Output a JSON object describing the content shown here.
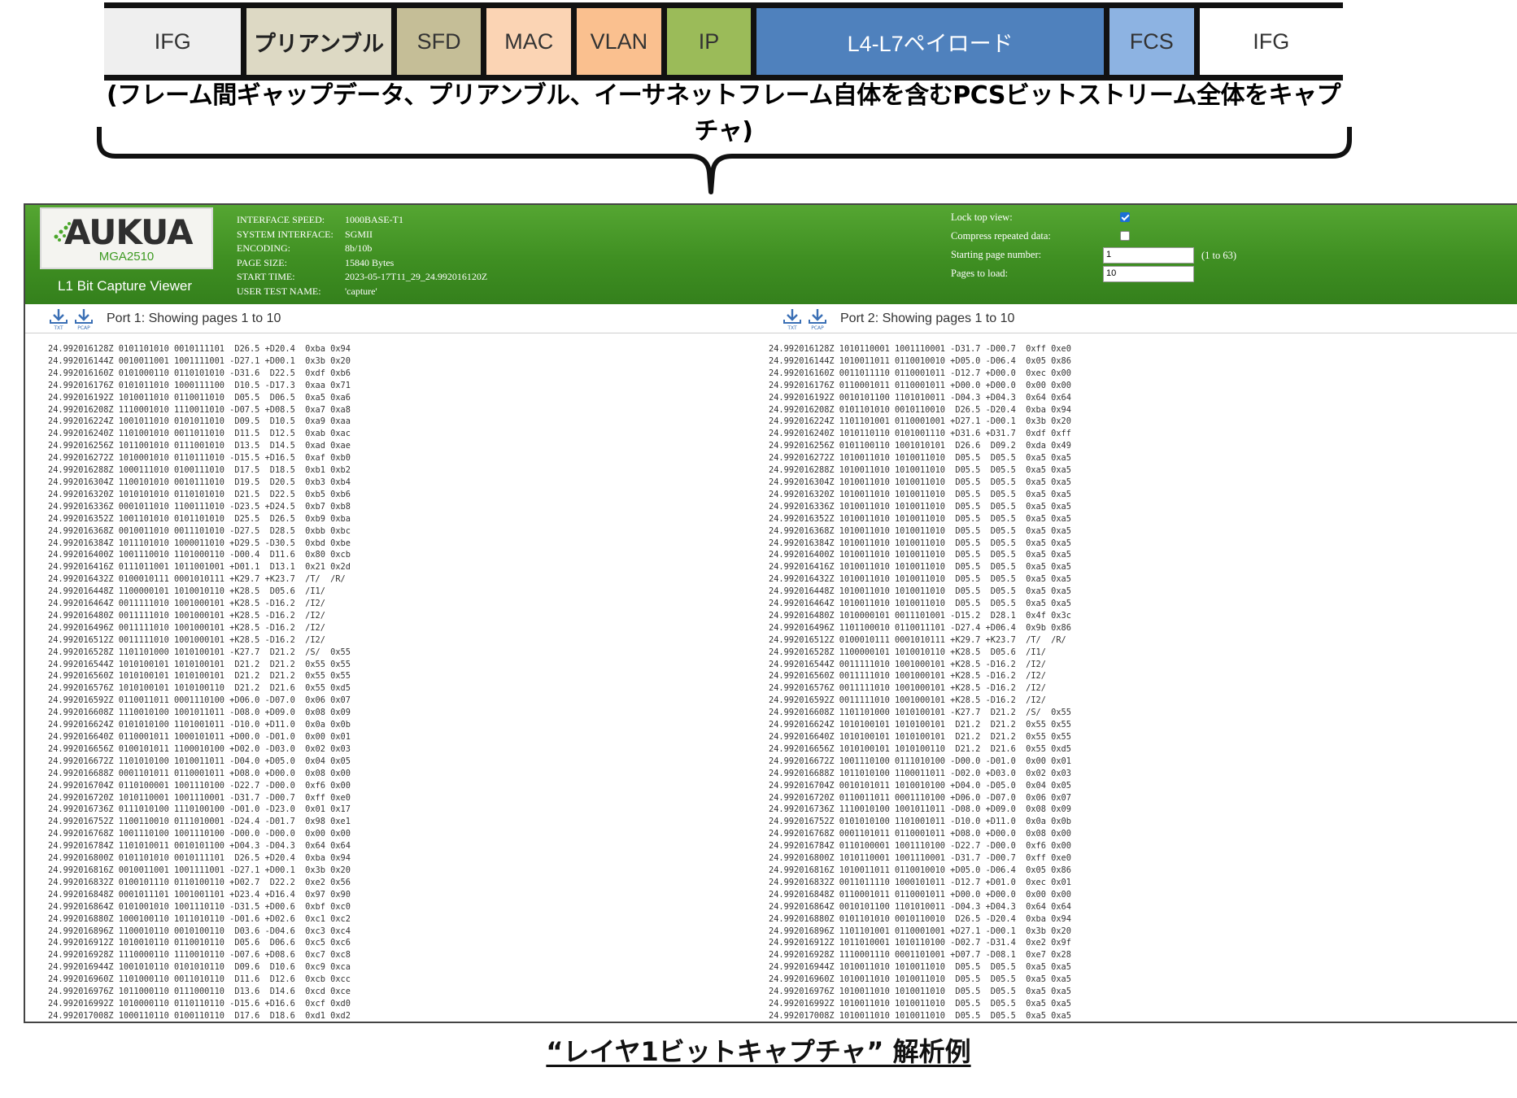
{
  "frame_strip": {
    "segments": [
      {
        "label": "IFG",
        "color": "#efefef",
        "text_color": "#333333",
        "bold": false
      },
      {
        "label": "プリアンブル",
        "color": "#ddd9c4",
        "text_color": "#222222",
        "bold": true
      },
      {
        "label": "SFD",
        "color": "#c5be97",
        "text_color": "#333333",
        "bold": false
      },
      {
        "label": "MAC",
        "color": "#fbd4b4",
        "text_color": "#333333",
        "bold": false
      },
      {
        "label": "VLAN",
        "color": "#fac08f",
        "text_color": "#333333",
        "bold": false
      },
      {
        "label": "IP",
        "color": "#9bbb59",
        "text_color": "#333333",
        "bold": false
      },
      {
        "label": "L4-L7ペイロード",
        "color": "#4f81bd",
        "text_color": "#ffffff",
        "bold": false
      },
      {
        "label": "FCS",
        "color": "#8db3e2",
        "text_color": "#333333",
        "bold": false
      },
      {
        "label": "IFG",
        "color": "#ffffff",
        "text_color": "#333333",
        "bold": false
      }
    ],
    "caption": "(フレーム間ギャップデータ、プリアンブル、イーサネットフレーム自体を含むPCSビットストリーム全体をキャプチャ)"
  },
  "viewer": {
    "logo_text": "AUKUA",
    "logo_model": "MGA2510",
    "app_title": "L1 Bit Capture Viewer",
    "info": [
      {
        "label": "INTERFACE SPEED:",
        "value": "1000BASE-T1"
      },
      {
        "label": "SYSTEM INTERFACE:",
        "value": "SGMII"
      },
      {
        "label": "ENCODING:",
        "value": "8b/10b"
      },
      {
        "label": "PAGE SIZE:",
        "value": "15840 Bytes"
      },
      {
        "label": "START TIME:",
        "value": "2023-05-17T11_29_24.992016120Z"
      },
      {
        "label": "USER TEST NAME:",
        "value": "'capture'"
      }
    ],
    "options": {
      "lock_top_view_label": "Lock top view:",
      "lock_top_view_checked": true,
      "compress_label": "Compress repeated data:",
      "compress_checked": false,
      "start_page_label": "Starting page number:",
      "start_page_value": "1",
      "start_page_hint": "(1 to 63)",
      "pages_to_load_label": "Pages to load:",
      "pages_to_load_value": "10"
    },
    "port1_title": "Port 1: Showing pages 1 to 10",
    "port2_title": "Port 2: Showing pages 1 to 10",
    "download_icons": [
      "txt-download-icon",
      "pcap-download-icon"
    ],
    "port1_lines": [
      "24.992016128Z 0101101010 0010111101  D26.5 +D20.4  0xba 0x94",
      "24.992016144Z 0010011001 1001111001 -D27.1 +D00.1  0x3b 0x20",
      "24.992016160Z 0101000110 0110101010 -D31.6  D22.5  0xdf 0xb6",
      "24.992016176Z 0101011010 1000111100  D10.5 -D17.3  0xaa 0x71",
      "24.992016192Z 1010011010 0110011010  D05.5  D06.5  0xa5 0xa6",
      "24.992016208Z 1110001010 1110011010 -D07.5 +D08.5  0xa7 0xa8",
      "24.992016224Z 1001011010 0101011010  D09.5  D10.5  0xa9 0xaa",
      "24.992016240Z 1101001010 0011011010  D11.5  D12.5  0xab 0xac",
      "24.992016256Z 1011001010 0111001010  D13.5  D14.5  0xad 0xae",
      "24.992016272Z 1010001010 0110111010 -D15.5 +D16.5  0xaf 0xb0",
      "24.992016288Z 1000111010 0100111010  D17.5  D18.5  0xb1 0xb2",
      "24.992016304Z 1100101010 0010111010  D19.5  D20.5  0xb3 0xb4",
      "24.992016320Z 1010101010 0110101010  D21.5  D22.5  0xb5 0xb6",
      "24.992016336Z 0001011010 1100111010 -D23.5 +D24.5  0xb7 0xb8",
      "24.992016352Z 1001101010 0101101010  D25.5  D26.5  0xb9 0xba",
      "24.992016368Z 0010011010 0011101010 -D27.5  D28.5  0xbb 0xbc",
      "24.992016384Z 1011101010 1000011010 +D29.5 -D30.5  0xbd 0xbe",
      "24.992016400Z 1001110010 1101000110 -D00.4  D11.6  0x80 0xcb",
      "24.992016416Z 0111011001 1011001001 +D01.1  D13.1  0x21 0x2d",
      "24.992016432Z 0100010111 0001010111 +K29.7 +K23.7  /T/  /R/",
      "24.992016448Z 1100000101 1010010110 +K28.5  D05.6  /I1/",
      "24.992016464Z 0011111010 1001000101 +K28.5 -D16.2  /I2/",
      "24.992016480Z 0011111010 1001000101 +K28.5 -D16.2  /I2/",
      "24.992016496Z 0011111010 1001000101 +K28.5 -D16.2  /I2/",
      "24.992016512Z 0011111010 1001000101 +K28.5 -D16.2  /I2/",
      "24.992016528Z 1101101000 1010100101 -K27.7  D21.2  /S/  0x55",
      "24.992016544Z 1010100101 1010100101  D21.2  D21.2  0x55 0x55",
      "24.992016560Z 1010100101 1010100101  D21.2  D21.2  0x55 0x55",
      "24.992016576Z 1010100101 1010100110  D21.2  D21.6  0x55 0xd5",
      "24.992016592Z 0110011011 0001110100 +D06.0 -D07.0  0x06 0x07",
      "24.992016608Z 1110010100 1001011011 -D08.0 +D09.0  0x08 0x09",
      "24.992016624Z 0101010100 1101001011 -D10.0 +D11.0  0x0a 0x0b",
      "24.992016640Z 0110001011 1000101011 +D00.0 -D01.0  0x00 0x01",
      "24.992016656Z 0100101011 1100010100 +D02.0 -D03.0  0x02 0x03",
      "24.992016672Z 1101010100 1010011011 -D04.0 +D05.0  0x04 0x05",
      "24.992016688Z 0001101011 0110001011 +D08.0 +D00.0  0x08 0x00",
      "24.992016704Z 0110100001 1001110100 -D22.7 -D00.0  0xf6 0x00",
      "24.992016720Z 1010110001 1001110001 -D31.7 -D00.7  0xff 0xe0",
      "24.992016736Z 0111010100 1110100100 -D01.0 -D23.0  0x01 0x17",
      "24.992016752Z 1100110010 0111010001 -D24.4 -D01.7  0x98 0xe1",
      "24.992016768Z 1001110100 1001110100 -D00.0 -D00.0  0x00 0x00",
      "24.992016784Z 1101010011 0010101100 +D04.3 -D04.3  0x64 0x64",
      "24.992016800Z 0101101010 0010111101  D26.5 +D20.4  0xba 0x94",
      "24.992016816Z 0010011001 1001111001 -D27.1 +D00.1  0x3b 0x20",
      "24.992016832Z 0100101110 0110100110 +D02.7  D22.2  0xe2 0x56",
      "24.992016848Z 0001011101 1001001101 +D23.4 +D16.4  0x97 0x90",
      "24.992016864Z 0101001010 1001110110 -D31.5 +D00.6  0xbf 0xc0",
      "24.992016880Z 1000100110 1011010110 -D01.6 +D02.6  0xc1 0xc2",
      "24.992016896Z 1100010110 0010100110  D03.6 -D04.6  0xc3 0xc4",
      "24.992016912Z 1010010110 0110010110  D05.6  D06.6  0xc5 0xc6",
      "24.992016928Z 1110000110 1110010110 -D07.6 +D08.6  0xc7 0xc8",
      "24.992016944Z 1001010110 0101010110  D09.6  D10.6  0xc9 0xca",
      "24.992016960Z 1101000110 0011010110  D11.6  D12.6  0xcb 0xcc",
      "24.992016976Z 1011000110 0111000110  D13.6  D14.6  0xcd 0xce",
      "24.992016992Z 1010000110 0110110110 -D15.6 +D16.6  0xcf 0xd0",
      "24.992017008Z 1000110110 0100110110  D17.6  D18.6  0xd1 0xd2"
    ],
    "port2_lines": [
      "24.992016128Z 1010110001 1001110001 -D31.7 -D00.7  0xff 0xe0",
      "24.992016144Z 1010011011 0110010010 +D05.0 -D06.4  0x05 0x86",
      "24.992016160Z 0011011110 0110001011 -D12.7 +D00.0  0xec 0x00",
      "24.992016176Z 0110001011 0110001011 +D00.0 +D00.0  0x00 0x00",
      "24.992016192Z 0010101100 1101010011 -D04.3 +D04.3  0x64 0x64",
      "24.992016208Z 0101101010 0010110010  D26.5 -D20.4  0xba 0x94",
      "24.992016224Z 1101101001 0110001001 +D27.1 -D00.1  0x3b 0x20",
      "24.992016240Z 1010110110 0101001110 +D31.6 +D31.7  0xdf 0xff",
      "24.992016256Z 0101100110 1001010101  D26.6  D09.2  0xda 0x49",
      "24.992016272Z 1010011010 1010011010  D05.5  D05.5  0xa5 0xa5",
      "24.992016288Z 1010011010 1010011010  D05.5  D05.5  0xa5 0xa5",
      "24.992016304Z 1010011010 1010011010  D05.5  D05.5  0xa5 0xa5",
      "24.992016320Z 1010011010 1010011010  D05.5  D05.5  0xa5 0xa5",
      "24.992016336Z 1010011010 1010011010  D05.5  D05.5  0xa5 0xa5",
      "24.992016352Z 1010011010 1010011010  D05.5  D05.5  0xa5 0xa5",
      "24.992016368Z 1010011010 1010011010  D05.5  D05.5  0xa5 0xa5",
      "24.992016384Z 1010011010 1010011010  D05.5  D05.5  0xa5 0xa5",
      "24.992016400Z 1010011010 1010011010  D05.5  D05.5  0xa5 0xa5",
      "24.992016416Z 1010011010 1010011010  D05.5  D05.5  0xa5 0xa5",
      "24.992016432Z 1010011010 1010011010  D05.5  D05.5  0xa5 0xa5",
      "24.992016448Z 1010011010 1010011010  D05.5  D05.5  0xa5 0xa5",
      "24.992016464Z 1010011010 1010011010  D05.5  D05.5  0xa5 0xa5",
      "24.992016480Z 1010000101 0011101001 -D15.2  D28.1  0x4f 0x3c",
      "24.992016496Z 1101100010 0110011101 -D27.4 +D06.4  0x9b 0x86",
      "24.992016512Z 0100010111 0001010111 +K29.7 +K23.7  /T/  /R/",
      "24.992016528Z 1100000101 1010010110 +K28.5  D05.6  /I1/",
      "24.992016544Z 0011111010 1001000101 +K28.5 -D16.2  /I2/",
      "24.992016560Z 0011111010 1001000101 +K28.5 -D16.2  /I2/",
      "24.992016576Z 0011111010 1001000101 +K28.5 -D16.2  /I2/",
      "24.992016592Z 0011111010 1001000101 +K28.5 -D16.2  /I2/",
      "24.992016608Z 1101101000 1010100101 -K27.7  D21.2  /S/  0x55",
      "24.992016624Z 1010100101 1010100101  D21.2  D21.2  0x55 0x55",
      "24.992016640Z 1010100101 1010100101  D21.2  D21.2  0x55 0x55",
      "24.992016656Z 1010100101 1010100110  D21.2  D21.6  0x55 0xd5",
      "24.992016672Z 1001110100 0111010100 -D00.0 -D01.0  0x00 0x01",
      "24.992016688Z 1011010100 1100011011 -D02.0 +D03.0  0x02 0x03",
      "24.992016704Z 0010101011 1010010100 +D04.0 -D05.0  0x04 0x05",
      "24.992016720Z 0110011011 0001110100 +D06.0 -D07.0  0x06 0x07",
      "24.992016736Z 1110010100 1001011011 -D08.0 +D09.0  0x08 0x09",
      "24.992016752Z 0101010100 1101001011 -D10.0 +D11.0  0x0a 0x0b",
      "24.992016768Z 0001101011 0110001011 +D08.0 +D00.0  0x08 0x00",
      "24.992016784Z 0110100001 1001110100 -D22.7 -D00.0  0xf6 0x00",
      "24.992016800Z 1010110001 1001110001 -D31.7 -D00.7  0xff 0xe0",
      "24.992016816Z 1010011011 0110010010 +D05.0 -D06.4  0x05 0x86",
      "24.992016832Z 0011011110 1000101011 -D12.7 +D01.0  0xec 0x01",
      "24.992016848Z 0110001011 0110001011 +D00.0 +D00.0  0x00 0x00",
      "24.992016864Z 0010101100 1101010011 -D04.3 +D04.3  0x64 0x64",
      "24.992016880Z 0101101010 0010110010  D26.5 -D20.4  0xba 0x94",
      "24.992016896Z 1101101001 0110001001 +D27.1 -D00.1  0x3b 0x20",
      "24.992016912Z 1011010001 1010110100 -D02.7 -D31.4  0xe2 0x9f",
      "24.992016928Z 1110001110 0001101001 +D07.7 -D08.1  0xe7 0x28",
      "24.992016944Z 1010011010 1010011010  D05.5  D05.5  0xa5 0xa5",
      "24.992016960Z 1010011010 1010011010  D05.5  D05.5  0xa5 0xa5",
      "24.992016976Z 1010011010 1010011010  D05.5  D05.5  0xa5 0xa5",
      "24.992016992Z 1010011010 1010011010  D05.5  D05.5  0xa5 0xa5",
      "24.992017008Z 1010011010 1010011010  D05.5  D05.5  0xa5 0xa5"
    ]
  },
  "bottom_caption": "“レイヤ1ビットキャプチャ” 解析例"
}
